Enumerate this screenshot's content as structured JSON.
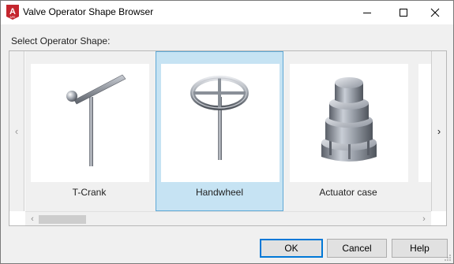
{
  "window": {
    "title": "Valve Operator Shape Browser",
    "icon": "autocad-app-icon",
    "controls": [
      "minimize-icon",
      "maximize-icon",
      "close-icon"
    ]
  },
  "prompt": "Select Operator Shape:",
  "browser": {
    "nav_left": "‹",
    "nav_right": "›",
    "tiles": [
      {
        "label": "T-Crank",
        "icon": "t-crank-shape",
        "selected": false
      },
      {
        "label": "Handwheel",
        "icon": "handwheel-shape",
        "selected": true
      },
      {
        "label": "Actuator case",
        "icon": "actuator-case-shape",
        "selected": false
      }
    ],
    "scroll_arrows": {
      "left": "‹",
      "right": "›"
    }
  },
  "buttons": {
    "ok": "OK",
    "cancel": "Cancel",
    "help": "Help"
  },
  "colors": {
    "selection_fill": "#c6e3f3",
    "selection_border": "#5fa9d6",
    "default_button_border": "#0078d7",
    "app_icon_red": "#c4262e"
  }
}
